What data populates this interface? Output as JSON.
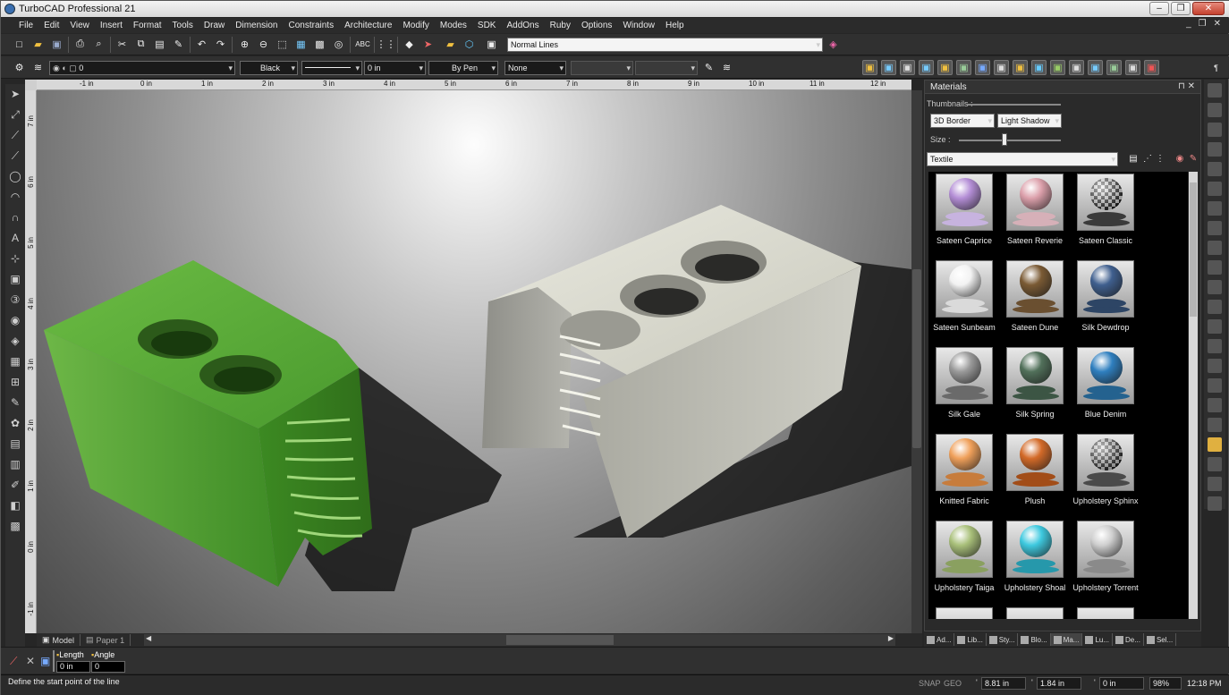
{
  "window": {
    "title": "TurboCAD Professional 21"
  },
  "menu": [
    "File",
    "Edit",
    "View",
    "Insert",
    "Format",
    "Tools",
    "Draw",
    "Dimension",
    "Constraints",
    "Architecture",
    "Modify",
    "Modes",
    "SDK",
    "AddOns",
    "Ruby",
    "Options",
    "Window",
    "Help"
  ],
  "toolbar1": {
    "line_style_value": "Normal Lines"
  },
  "toolbar2": {
    "layer_value": "0",
    "color_value": "Black",
    "width_value": "0 in",
    "pen_value": "By Pen",
    "fill_value": "None"
  },
  "ruler": {
    "h_labels": [
      "-1 in",
      "0 in",
      "1 in",
      "2 in",
      "3 in",
      "4 in",
      "5 in",
      "6 in",
      "7 in",
      "8 in",
      "9 in",
      "10 in",
      "11 in",
      "12 in"
    ],
    "v_labels": [
      "7 in",
      "6 in",
      "5 in",
      "4 in",
      "3 in",
      "2 in",
      "1 in",
      "0 in",
      "-1 in"
    ]
  },
  "sheet_tabs": [
    {
      "label": "Model",
      "active": true
    },
    {
      "label": "Paper 1",
      "active": false
    }
  ],
  "materials_panel": {
    "title": "Materials",
    "thumbnails_label": "Thumbnails :",
    "border_option": "3D Border",
    "shadow_option": "Light Shadow",
    "size_label": "Size :",
    "size_level": 0.45,
    "category": "Textile",
    "items": [
      {
        "name": "Sateen Caprice",
        "color": "#b48ed6",
        "pedestal": "#c7b3df"
      },
      {
        "name": "Sateen Reverie",
        "color": "#dca0ab",
        "pedestal": "#d6b0b8"
      },
      {
        "name": "Sateen Classic",
        "color": "#e6e6e6",
        "pedestal": "#3a3a3a",
        "pattern": "checker"
      },
      {
        "name": "Sateen Sunbeam",
        "color": "#f2f2f2",
        "pedestal": "#dadada"
      },
      {
        "name": "Sateen Dune",
        "color": "#7a5a34",
        "pedestal": "#6a4f30"
      },
      {
        "name": "Silk Dewdrop",
        "color": "#3f5f8e",
        "pedestal": "#2d4565"
      },
      {
        "name": "Silk Gale",
        "color": "#9a9a9a",
        "pedestal": "#6a6a6a"
      },
      {
        "name": "Silk Spring",
        "color": "#51705a",
        "pedestal": "#3c5544"
      },
      {
        "name": "Blue Denim",
        "color": "#2f7fbf",
        "pedestal": "#24628f"
      },
      {
        "name": "Knitted Fabric",
        "color": "#f0a05a",
        "pedestal": "#c77c3c"
      },
      {
        "name": "Plush",
        "color": "#d36a28",
        "pedestal": "#a24d18"
      },
      {
        "name": "Upholstery Sphinx",
        "color": "#cfcfcf",
        "pedestal": "#4a4a4a",
        "pattern": "checker"
      },
      {
        "name": "Upholstery Taiga",
        "color": "#a9c07a",
        "pedestal": "#8aa060"
      },
      {
        "name": "Upholstery Shoal",
        "color": "#3ec9df",
        "pedestal": "#2698ab"
      },
      {
        "name": "Upholstery Torrent",
        "color": "#cfcfcf",
        "pedestal": "#8a8a8a"
      }
    ]
  },
  "panel_tabs": [
    "Ad...",
    "Lib...",
    "Sty...",
    "Blo...",
    "Ma...",
    "Lu...",
    "De...",
    "Sel..."
  ],
  "panel_tabs_active": 4,
  "inspector": {
    "length_label": "Length",
    "angle_label": "Angle",
    "length_value": "0 in",
    "angle_value": "0"
  },
  "status": {
    "prompt": "Define the start point of the line",
    "snap": "SNAP",
    "geo": "GEO",
    "x": "8.81 in",
    "y": "1.84 in",
    "z": "0 in",
    "zoom": "98%",
    "time": "12:18 PM"
  },
  "colors": {
    "green_part": "#5aa83a",
    "white_part": "#dcdcd0",
    "accent": "#3a6fb0"
  }
}
